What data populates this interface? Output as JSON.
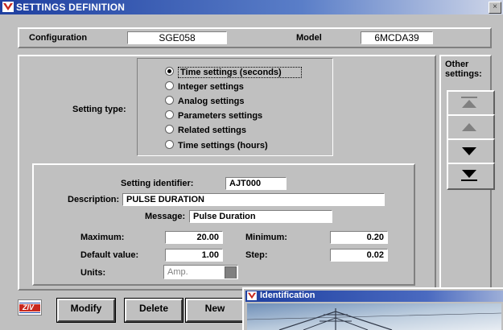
{
  "window": {
    "title": "SETTINGS DEFINITION",
    "close_glyph": "×"
  },
  "header": {
    "configuration_label": "Configuration",
    "configuration_value": "SGE058",
    "model_label": "Model",
    "model_value": "6MCDA39"
  },
  "setting_type": {
    "label": "Setting type:",
    "options": [
      {
        "label": "Time settings (seconds)",
        "selected": true
      },
      {
        "label": "Integer settings",
        "selected": false
      },
      {
        "label": "Analog settings",
        "selected": false
      },
      {
        "label": "Parameters settings",
        "selected": false
      },
      {
        "label": "Related settings",
        "selected": false
      },
      {
        "label": "Time settings (hours)",
        "selected": false
      }
    ]
  },
  "other_settings": {
    "label": "Other settings:",
    "buttons": [
      "first-icon",
      "previous-icon",
      "next-icon",
      "last-icon"
    ]
  },
  "detail": {
    "identifier_label": "Setting identifier:",
    "identifier_value": "AJT000",
    "description_label": "Description:",
    "description_value": "PULSE DURATION",
    "message_label": "Message:",
    "message_value": "Pulse Duration",
    "maximum_label": "Maximum:",
    "maximum_value": "20.00",
    "minimum_label": "Minimum:",
    "minimum_value": "0.20",
    "default_label": "Default value:",
    "default_value": "1.00",
    "step_label": "Step:",
    "step_value": "0.02",
    "units_label": "Units:",
    "units_value": "Amp."
  },
  "footer": {
    "logo_text": "ZIV",
    "buttons": [
      "Modify",
      "Delete",
      "New"
    ]
  },
  "identification_window": {
    "title": "Identification"
  },
  "colors": {
    "titlebar": "#1e3fa0",
    "face": "#c0c0c0",
    "field": "#ffffff",
    "icon_red": "#c8281e"
  }
}
